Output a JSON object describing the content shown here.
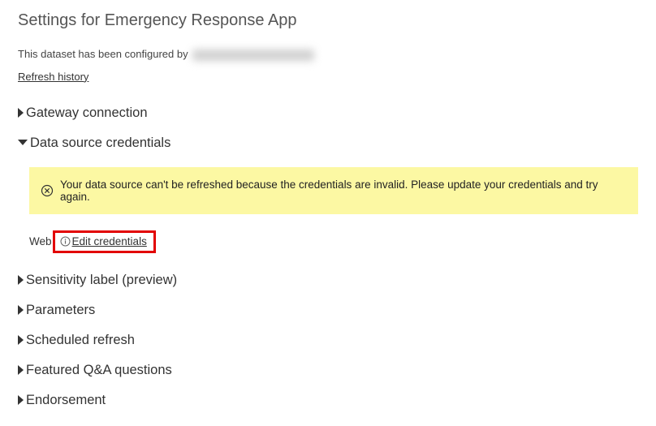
{
  "page": {
    "title": "Settings for Emergency Response App",
    "configuredPrefix": "This dataset has been configured by",
    "refreshHistory": "Refresh history"
  },
  "sections": {
    "gateway": {
      "label": "Gateway connection"
    },
    "credentials": {
      "label": "Data source credentials",
      "alertText": "Your data source can't be refreshed because the credentials are invalid. Please update your credentials and try again.",
      "sourceLabel": "Web",
      "editLabel": "Edit credentials"
    },
    "sensitivity": {
      "label": "Sensitivity label (preview)"
    },
    "parameters": {
      "label": "Parameters"
    },
    "scheduled": {
      "label": "Scheduled refresh"
    },
    "featuredQA": {
      "label": "Featured Q&A questions"
    },
    "endorsement": {
      "label": "Endorsement"
    }
  }
}
